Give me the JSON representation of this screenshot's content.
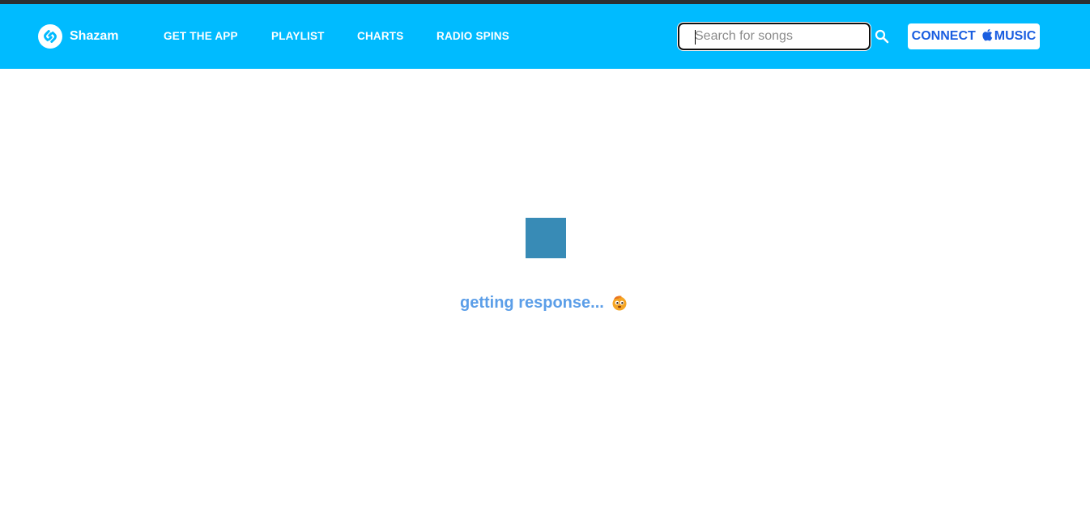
{
  "header": {
    "brand_name": "Shazam",
    "nav": [
      {
        "label": "GET THE APP"
      },
      {
        "label": "PLAYLIST"
      },
      {
        "label": "CHARTS"
      },
      {
        "label": "RADIO SPINS"
      }
    ],
    "search": {
      "placeholder": "Search for songs",
      "value": ""
    },
    "connect_button": {
      "label_prefix": "CONNECT",
      "label_suffix": "MUSIC",
      "icon": "apple-icon"
    }
  },
  "main": {
    "status_text": "getting response...",
    "status_icon": "thinking-emoji-icon"
  },
  "colors": {
    "navbar": "#00bbff",
    "top_strip": "#2b2f33",
    "accent_text": "#1a5ee0",
    "loader": "#388bb6",
    "status_text": "#5b9ee8"
  }
}
